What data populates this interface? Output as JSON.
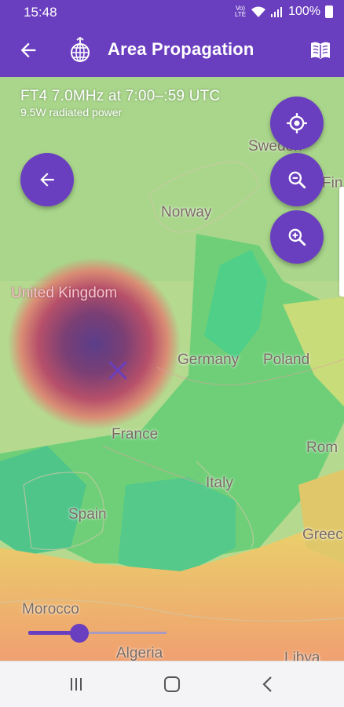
{
  "status_bar": {
    "time": "15:48",
    "volte": "Vo)) LTE",
    "battery": "100%"
  },
  "app_bar": {
    "title": "Area Propagation"
  },
  "overlay": {
    "band_line": "FT4 7.0MHz at 7:00–:59 UTC",
    "power_line": "9.5W radiated power"
  },
  "map": {
    "countries": {
      "sweden": "Sweden",
      "norway": "Norway",
      "uk": "United Kingdom",
      "germany": "Germany",
      "poland": "Poland",
      "france": "France",
      "italy": "Italy",
      "spain": "Spain",
      "morocco": "Morocco",
      "algeria": "Algeria",
      "greece": "Greec",
      "romania": "Rom",
      "libya": "Libya",
      "finland": "Fin"
    }
  },
  "controls": {
    "my_location_icon": "crosshair-icon",
    "zoom_out_icon": "zoom-out-icon",
    "zoom_in_icon": "zoom-in-icon",
    "time_slider_position": 0.37
  },
  "colors": {
    "accent": "#6a3fbf",
    "strong_signal": "#3fbf6a",
    "weak_signal": "#e8d36a",
    "no_signal": "#7a2a55"
  }
}
